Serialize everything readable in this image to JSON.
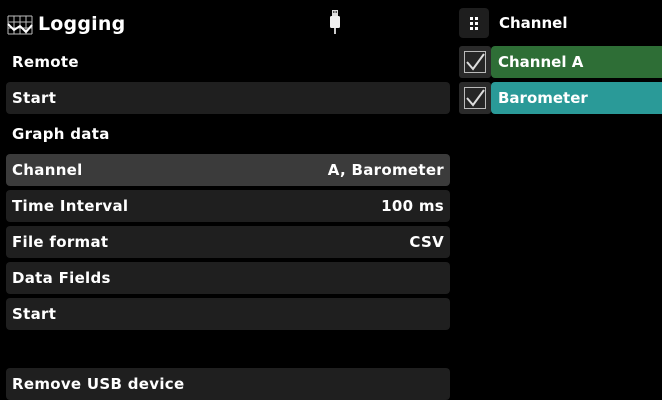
{
  "header": {
    "title": "Logging",
    "title_icon": "chart-icon",
    "status_icon": "usb-icon"
  },
  "menu": {
    "remote": "Remote",
    "start_top": "Start",
    "graph_data": "Graph data",
    "channel": {
      "label": "Channel",
      "value": "A, Barometer"
    },
    "time_interval": {
      "label": "Time Interval",
      "value": "100 ms"
    },
    "file_format": {
      "label": "File format",
      "value": "CSV"
    },
    "data_fields": "Data Fields",
    "start_bottom": "Start",
    "remove_usb": "Remove USB device"
  },
  "channel_panel": {
    "title": "Channel",
    "grid_icon": "grid-icon",
    "items": [
      {
        "label": "Channel A",
        "checked": true,
        "color": "#2e6e36"
      },
      {
        "label": "Barometer",
        "checked": true,
        "color": "#2a9a98"
      }
    ]
  },
  "colors": {
    "background": "#000000",
    "row_dark": "#1f1f1f",
    "row_selected": "#3b3b3b",
    "channel_a": "#2e6e36",
    "barometer": "#2a9a98"
  }
}
